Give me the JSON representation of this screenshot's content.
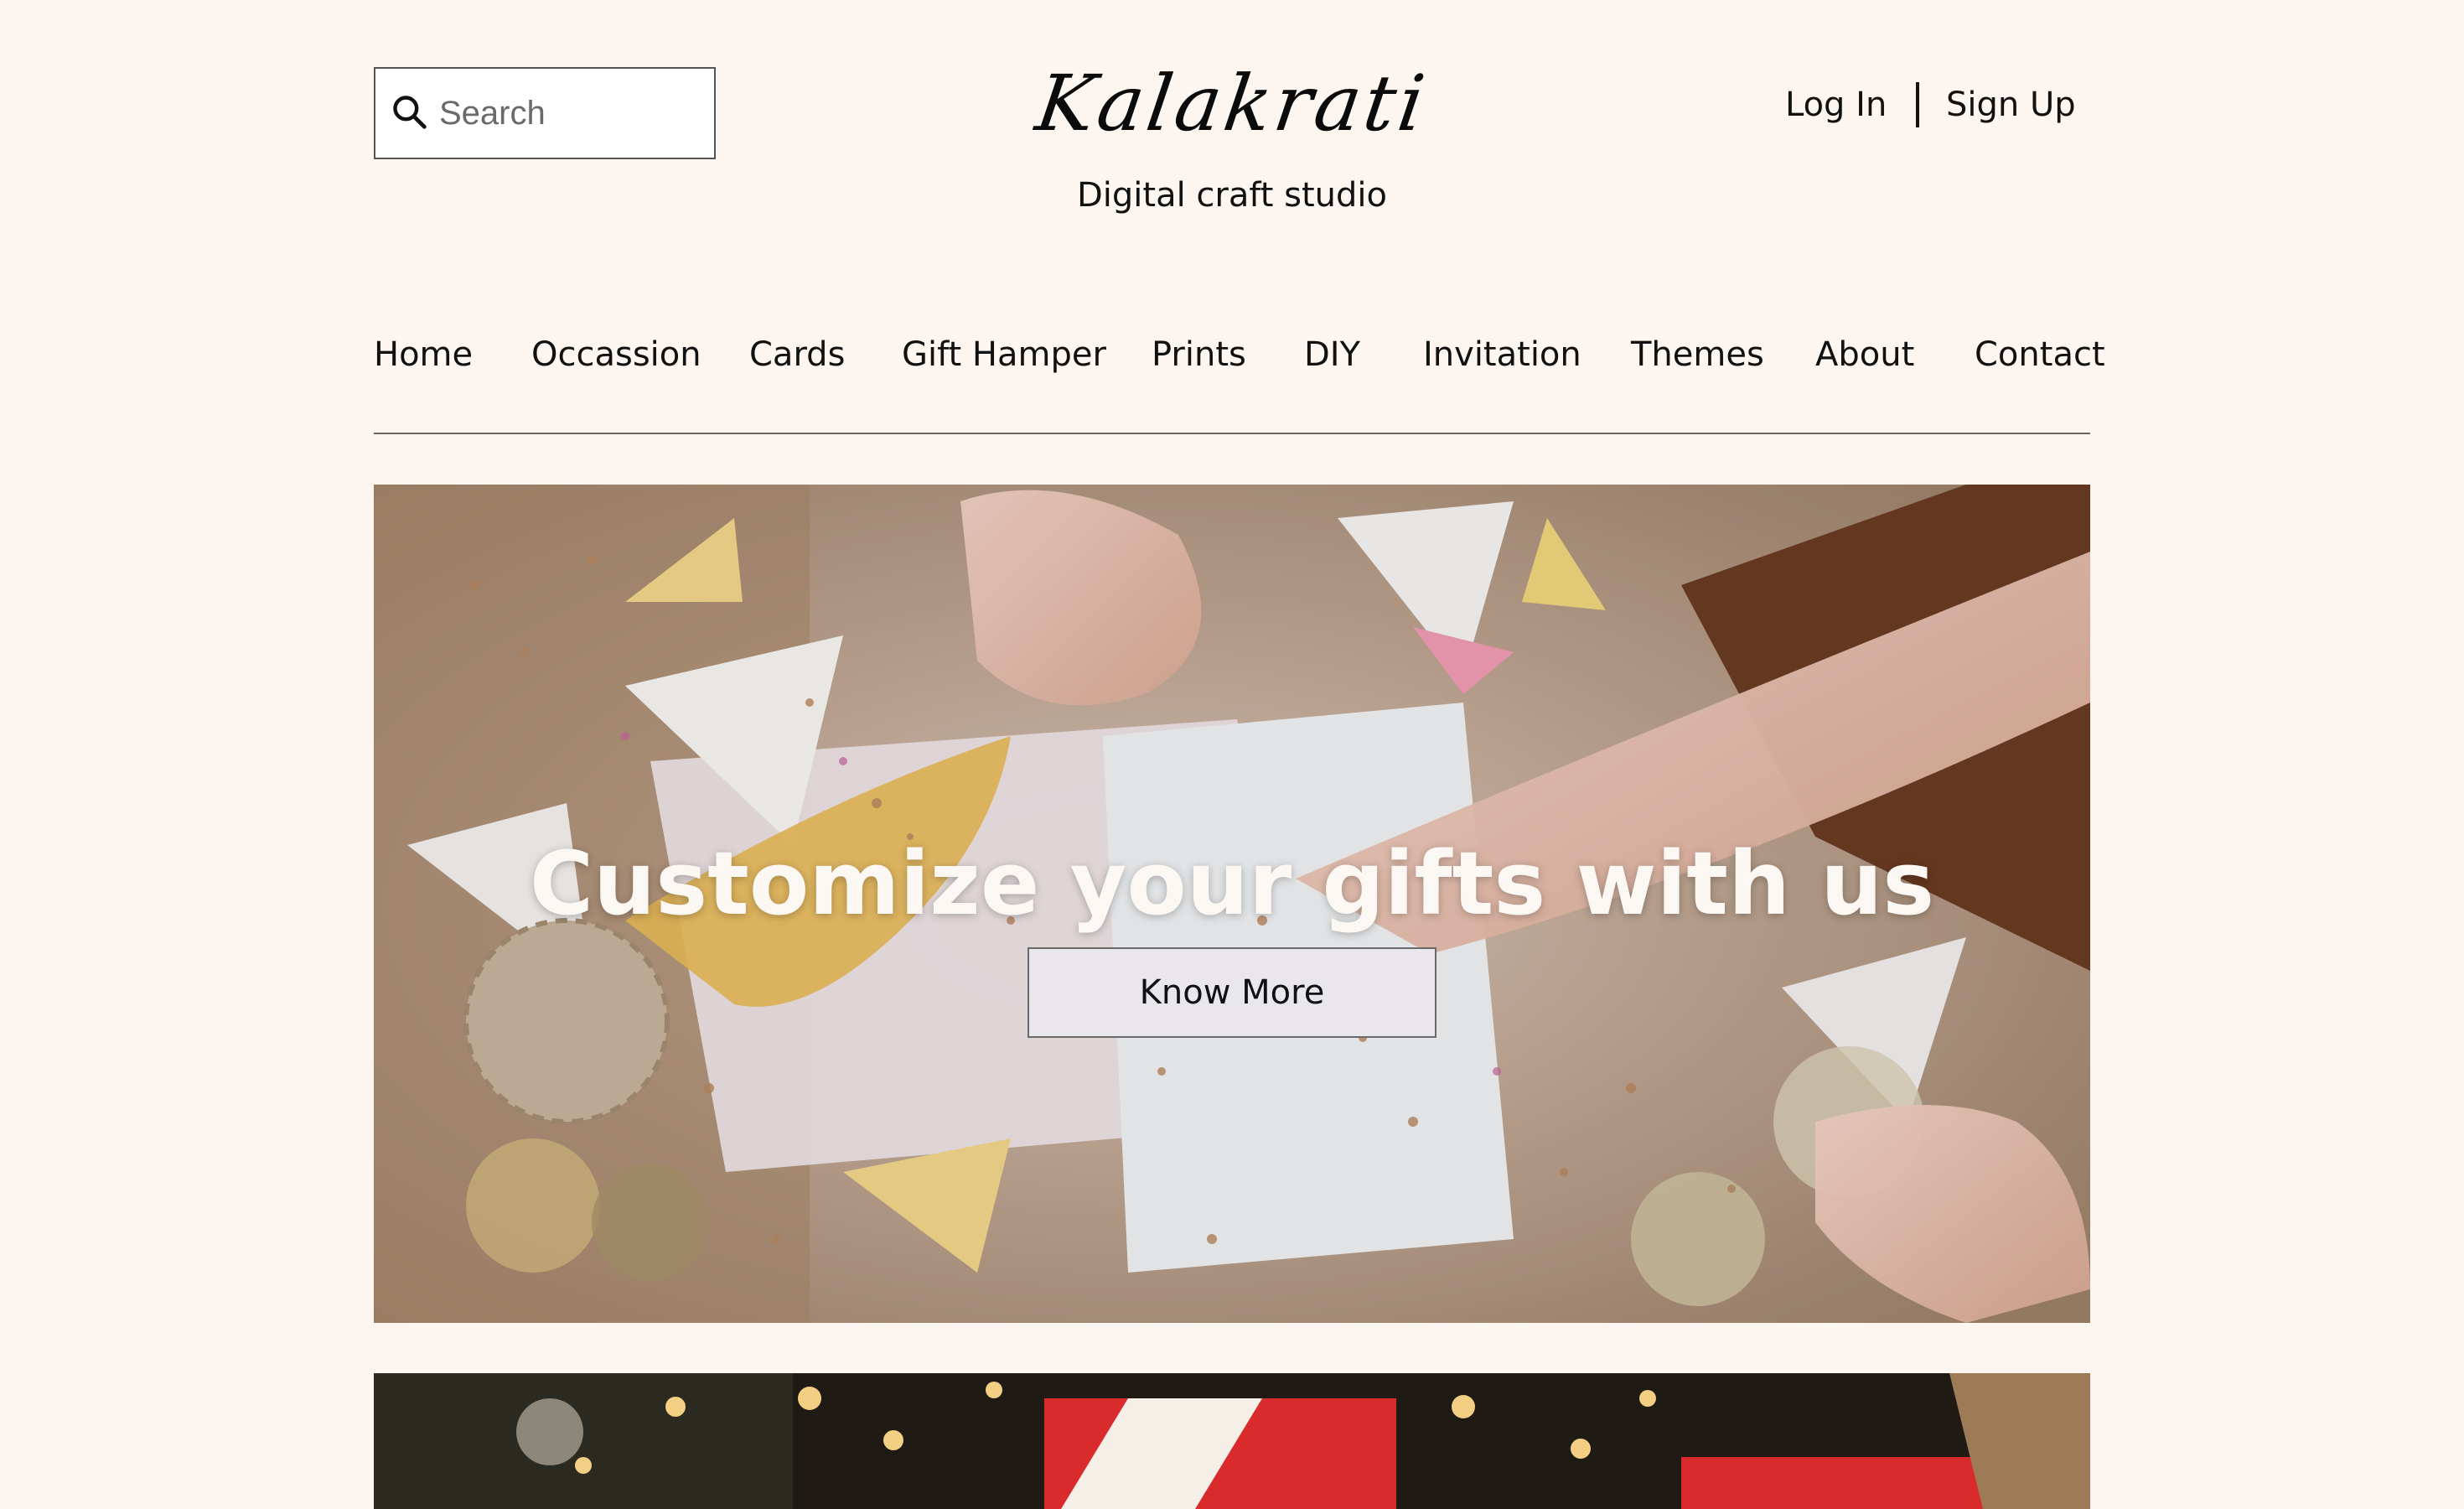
{
  "header": {
    "search": {
      "placeholder": "Search",
      "value": ""
    },
    "brand": {
      "logo": "Kalakrati",
      "tagline": "Digital craft studio"
    },
    "auth": {
      "login": "Log In",
      "signup": "Sign Up"
    }
  },
  "nav": {
    "items": [
      "Home",
      "Occassion",
      "Cards",
      "Gift Hamper",
      "Prints",
      "DIY",
      "Invitation",
      "Themes",
      "About",
      "Contact"
    ]
  },
  "hero": {
    "title": "Customize your gifts with us",
    "cta": "Know More"
  },
  "colors": {
    "page_bg": "#fdf6f0",
    "text": "#111111",
    "button_bg": "#e9e7ec"
  }
}
